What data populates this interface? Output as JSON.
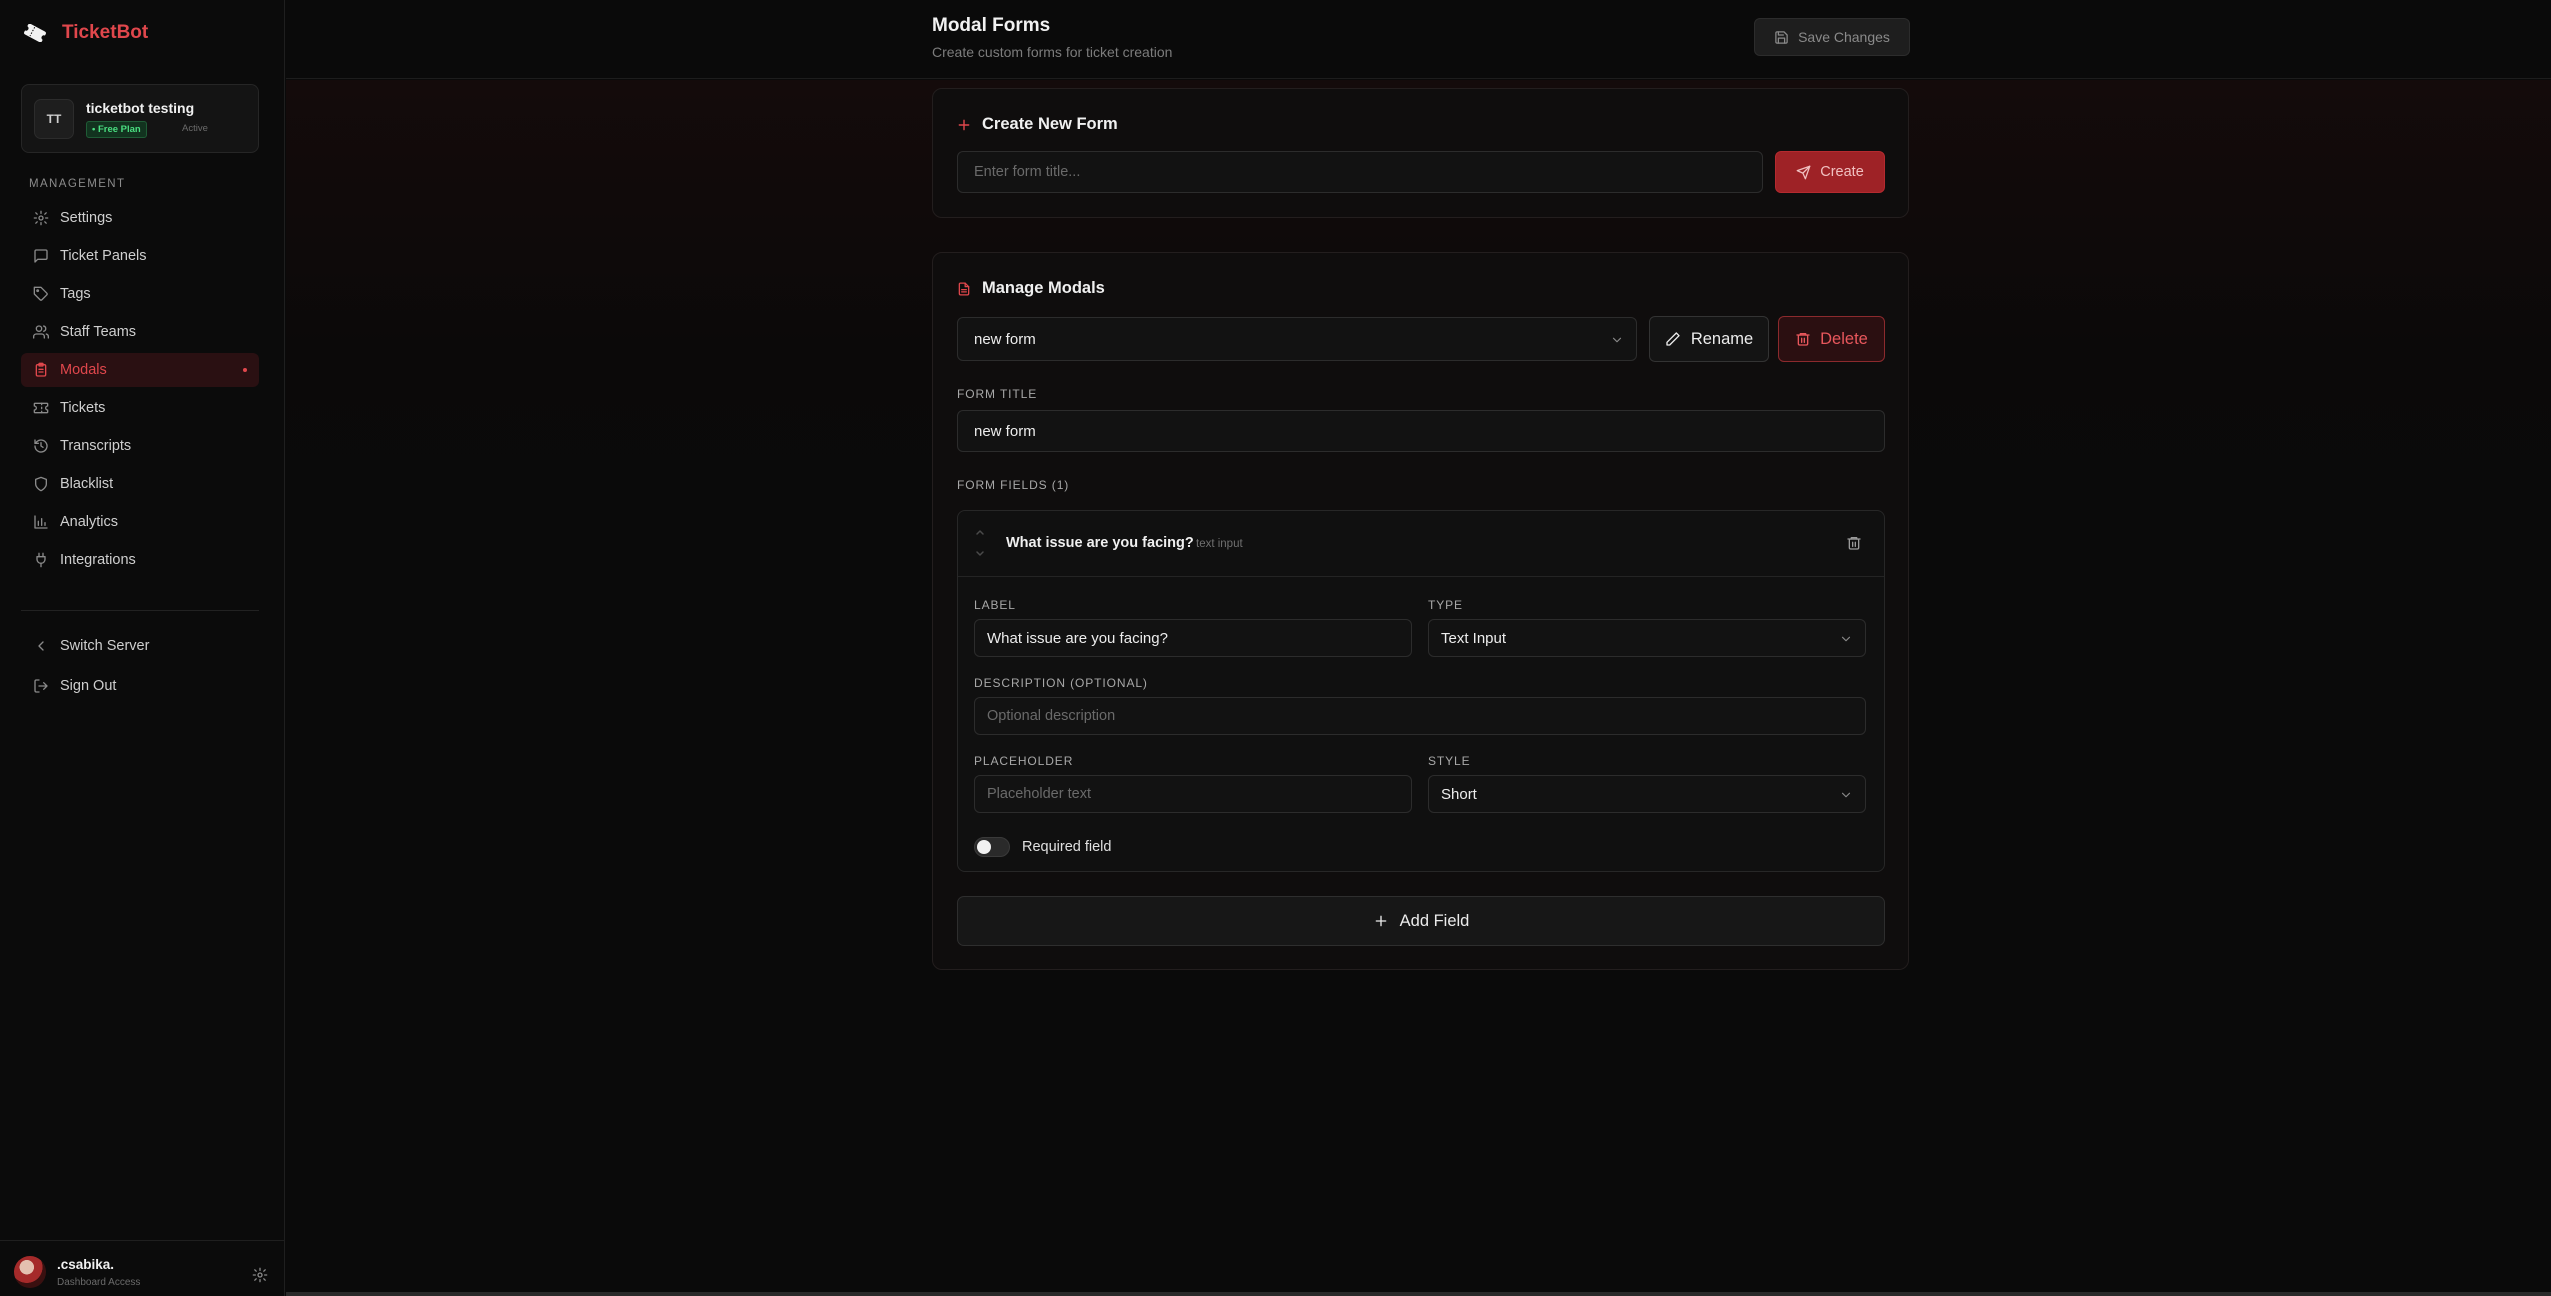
{
  "brand": {
    "name": "TicketBot",
    "logo_icon": "ticket-icon"
  },
  "server": {
    "avatar_initials": "TT",
    "name": "ticketbot testing",
    "plan": "• Free Plan",
    "status": "Active"
  },
  "sidebar": {
    "section_label": "MANAGEMENT",
    "items": [
      {
        "label": "Settings",
        "icon": "gear-icon"
      },
      {
        "label": "Ticket Panels",
        "icon": "message-square-icon"
      },
      {
        "label": "Tags",
        "icon": "tag-icon"
      },
      {
        "label": "Staff Teams",
        "icon": "users-icon"
      },
      {
        "label": "Modals",
        "icon": "clipboard-icon",
        "active": true
      },
      {
        "label": "Tickets",
        "icon": "ticket-icon"
      },
      {
        "label": "Transcripts",
        "icon": "history-icon"
      },
      {
        "label": "Blacklist",
        "icon": "shield-icon"
      },
      {
        "label": "Analytics",
        "icon": "bar-chart-icon"
      },
      {
        "label": "Integrations",
        "icon": "plug-icon"
      }
    ],
    "switch_server": "Switch Server",
    "sign_out": "Sign Out"
  },
  "user": {
    "name": ".csabika.",
    "role": "Dashboard Access"
  },
  "header": {
    "title": "Modal Forms",
    "subtitle": "Create custom forms for ticket creation",
    "save_label": "Save Changes"
  },
  "create_form": {
    "title": "Create New Form",
    "input_placeholder": "Enter form title...",
    "input_value": "",
    "create_label": "Create"
  },
  "manage": {
    "title": "Manage Modals",
    "selected_form": "new form",
    "rename_label": "Rename",
    "delete_label": "Delete",
    "form_title_label": "FORM TITLE",
    "form_title_value": "new form",
    "form_fields_label": "FORM FIELDS (1)",
    "fields": [
      {
        "name": "What issue are you facing?",
        "type_tag": "text input",
        "label_caption": "LABEL",
        "label_value": "What issue are you facing?",
        "type_caption": "TYPE",
        "type_value": "Text Input",
        "description_caption": "DESCRIPTION (OPTIONAL)",
        "description_placeholder": "Optional description",
        "placeholder_caption": "PLACEHOLDER",
        "placeholder_placeholder": "Placeholder text",
        "style_caption": "STYLE",
        "style_value": "Short",
        "required_label": "Required field",
        "required": false
      }
    ],
    "add_field_label": "Add Field"
  },
  "colors": {
    "accent": "#e0474c",
    "background": "#0a0a0a",
    "plan_green": "#4ade80"
  }
}
